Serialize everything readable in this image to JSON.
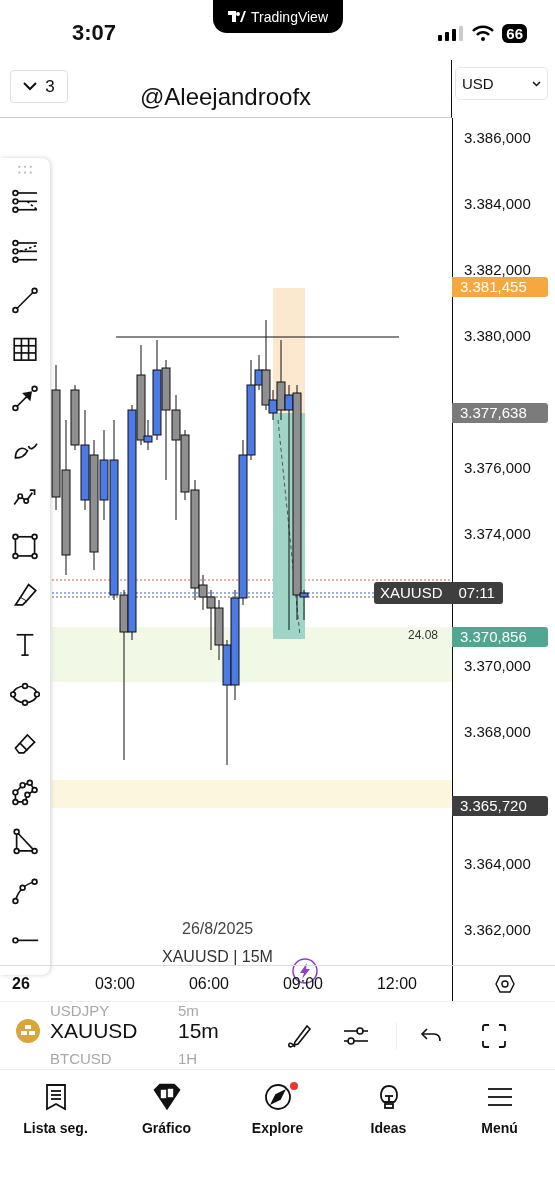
{
  "status_bar": {
    "time": "3:07",
    "app_pill": "TradingView",
    "battery": "66"
  },
  "header": {
    "layout_count": "3",
    "title": "@Aleejandroofx",
    "currency": "USD"
  },
  "price_axis": {
    "ticks": [
      "3.386,000",
      "3.384,000",
      "3.382,000",
      "3.380,000",
      "3.376,000",
      "3.374,000",
      "3.370,000",
      "3.368,000",
      "3.364,000",
      "3.362,000"
    ],
    "tags": [
      {
        "text": "3.381,455",
        "color": "#f6a83e"
      },
      {
        "text": "3.377,638",
        "color": "#7b7b7b"
      },
      {
        "text": "3.370,856",
        "color": "#4fa791"
      },
      {
        "text": "3.365,720",
        "color": "#3d3d3d"
      }
    ]
  },
  "countdown_tag": {
    "symbol": "XAUUSD",
    "countdown": "07:11"
  },
  "position_label": "24.08",
  "chart": {
    "date": "26/8/2025",
    "legend": "XAUUSD | 15M"
  },
  "time_axis": {
    "day": "26",
    "ticks": [
      "03:00",
      "06:00",
      "09:00",
      "12:00"
    ]
  },
  "symbol_bar": {
    "previous": {
      "symbol": "USDJPY",
      "interval": "5m"
    },
    "symbol": "XAUUSD",
    "interval": "15m",
    "next": {
      "symbol": "BTCUSD",
      "interval": "1H"
    }
  },
  "nav": [
    {
      "label": "Lista seg.",
      "selected": false,
      "notification": false
    },
    {
      "label": "Gráfico",
      "selected": true,
      "notification": false
    },
    {
      "label": "Explore",
      "selected": false,
      "notification": true
    },
    {
      "label": "Ideas",
      "selected": false,
      "notification": false
    },
    {
      "label": "Menú",
      "selected": false,
      "notification": false
    }
  ]
}
